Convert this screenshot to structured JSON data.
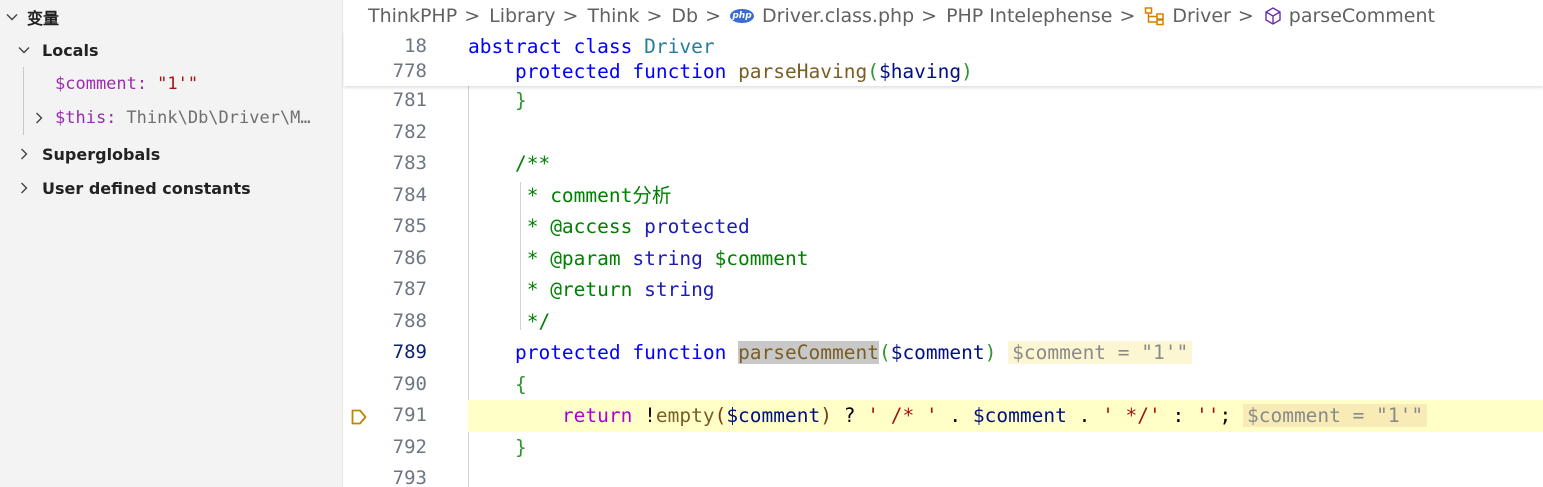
{
  "sidebar": {
    "title": "变量",
    "locals_label": "Locals",
    "locals": [
      {
        "name": "$comment:",
        "value": "\"1'\""
      },
      {
        "name": "$this:",
        "value": "Think\\Db\\Driver\\M…"
      }
    ],
    "superglobals_label": "Superglobals",
    "constants_label": "User defined constants"
  },
  "breadcrumb": {
    "items": [
      "ThinkPHP",
      "Library",
      "Think",
      "Db",
      "Driver.class.php",
      "PHP Intelephense",
      "Driver",
      "parseComment"
    ],
    "separator": ">",
    "php_badge": "php"
  },
  "sticky": {
    "lines": [
      {
        "num": "18",
        "abstract": "abstract",
        "class": "class",
        "name": "Driver"
      },
      {
        "num": "778",
        "protected": "protected",
        "function": "function",
        "fname": "parseHaving",
        "open": "(",
        "param": "$having",
        "close": ")"
      }
    ]
  },
  "code": {
    "line_numbers": [
      "781",
      "782",
      "783",
      "784",
      "785",
      "786",
      "787",
      "788",
      "789",
      "790",
      "791",
      "792",
      "793"
    ],
    "l781": "}",
    "l783": "/**",
    "l784": " * comment分析",
    "l785a": " * @access ",
    "l785b": "protected",
    "l786a": " * @param ",
    "l786b": "string",
    "l786c": " $comment",
    "l787a": " * @return ",
    "l787b": "string",
    "l788": " */",
    "l789": {
      "protected": "protected",
      "function": "function",
      "fname": "parseComment",
      "open": "(",
      "param": "$comment",
      "close": ")",
      "inlay": "$comment = \"1'\""
    },
    "l790": "{",
    "l791": {
      "return": "return",
      "bang": " !",
      "empty": "empty",
      "open": "(",
      "param": "$comment",
      "close": ")",
      "q": " ? ",
      "s1": "' /* '",
      "dot1": " . ",
      "var": "$comment",
      "dot2": " . ",
      "s2": "' */'",
      "colon": " : ",
      "s3": "''",
      "semi": ";",
      "inlay": "$comment = \"1'\""
    },
    "l792": "}"
  },
  "colors": {
    "keyword": "#0000ff",
    "function": "#795e26",
    "variable": "#001080",
    "comment": "#008000",
    "string": "#a31515",
    "control": "#af00db",
    "current_line": "#ffffc7",
    "breakpoint": "#be8700"
  }
}
